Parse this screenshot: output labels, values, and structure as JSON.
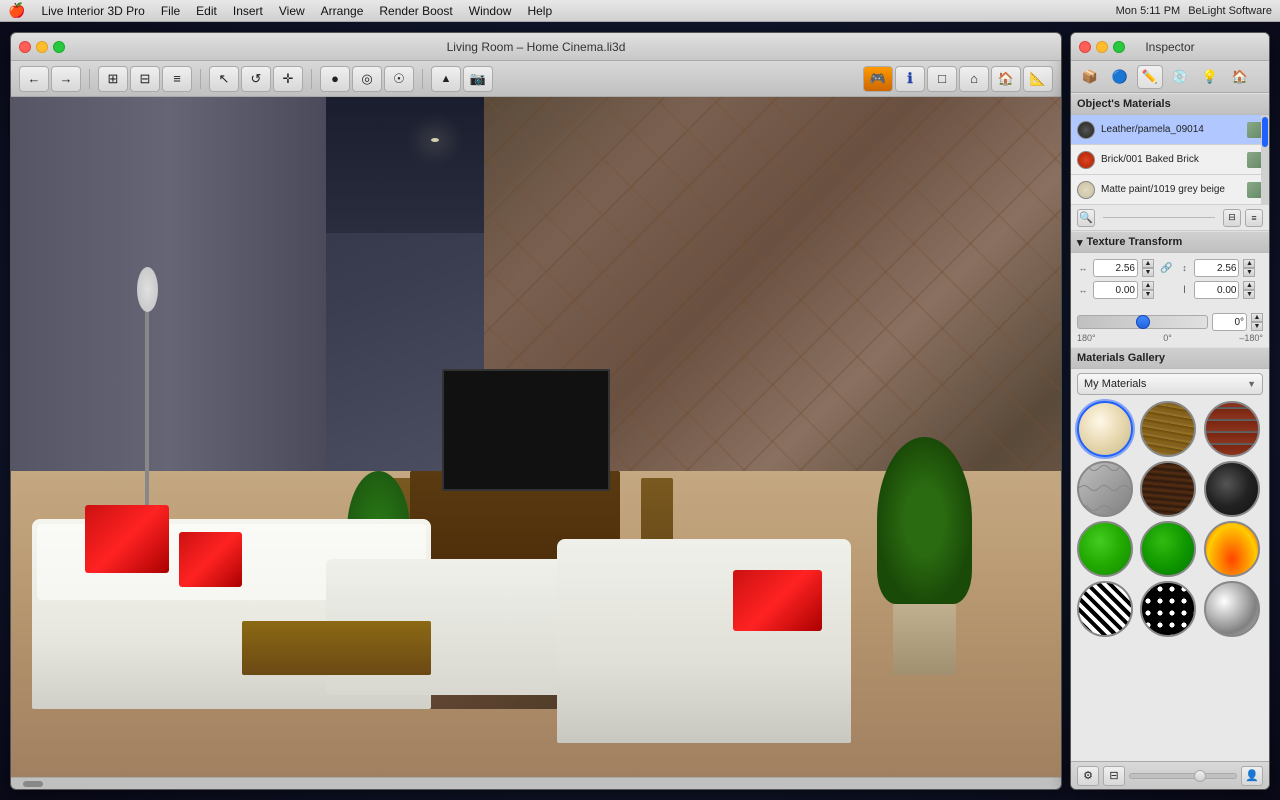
{
  "menubar": {
    "apple": "🍎",
    "items": [
      "Live Interior 3D Pro",
      "File",
      "Edit",
      "Insert",
      "View",
      "Arrange",
      "Render Boost",
      "Window",
      "Help"
    ],
    "right": {
      "time": "Mon 5:11 PM",
      "brand": "BeLight Software"
    }
  },
  "window3d": {
    "title": "Living Room – Home Cinema.li3d",
    "toolbar_buttons": [
      "←",
      "→",
      "⊞",
      "✎",
      "⊟",
      "●",
      "◎",
      "☉",
      "🔺",
      "📷",
      "🎮",
      "ℹ",
      "□",
      "⌂",
      "🏠",
      "📐"
    ]
  },
  "inspector": {
    "title": "Inspector",
    "tabs": [
      "📦",
      "🔵",
      "✏️",
      "💿",
      "💡",
      "🏠"
    ],
    "materials_section": {
      "label": "Object's Materials",
      "items": [
        {
          "name": "Leather/pamela_09014",
          "color": "#3a3a3a"
        },
        {
          "name": "Brick/001 Baked Brick",
          "color": "#cc3311"
        },
        {
          "name": "Matte paint/1019 grey beige",
          "color": "#d4c8b0"
        }
      ]
    },
    "texture_transform": {
      "label": "Texture Transform",
      "width_value": "2.56",
      "height_value": "2.56",
      "offset_x": "0.00",
      "offset_y": "0.00",
      "rotation": "0°",
      "rotation_min": "180°",
      "rotation_mid": "0°",
      "rotation_max": "–180°"
    },
    "gallery": {
      "label": "Materials Gallery",
      "dropdown_value": "My Materials",
      "items": [
        {
          "id": "cream",
          "label": "Cream"
        },
        {
          "id": "wood1",
          "label": "Light Wood"
        },
        {
          "id": "brick",
          "label": "Brick"
        },
        {
          "id": "stone",
          "label": "Stone"
        },
        {
          "id": "dark-wood",
          "label": "Dark Wood"
        },
        {
          "id": "dark2",
          "label": "Dark"
        },
        {
          "id": "green1",
          "label": "Green"
        },
        {
          "id": "green2",
          "label": "Dark Green"
        },
        {
          "id": "fire",
          "label": "Fire"
        },
        {
          "id": "zebra",
          "label": "Zebra"
        },
        {
          "id": "dots",
          "label": "Dots"
        },
        {
          "id": "silver",
          "label": "Silver"
        }
      ]
    }
  }
}
